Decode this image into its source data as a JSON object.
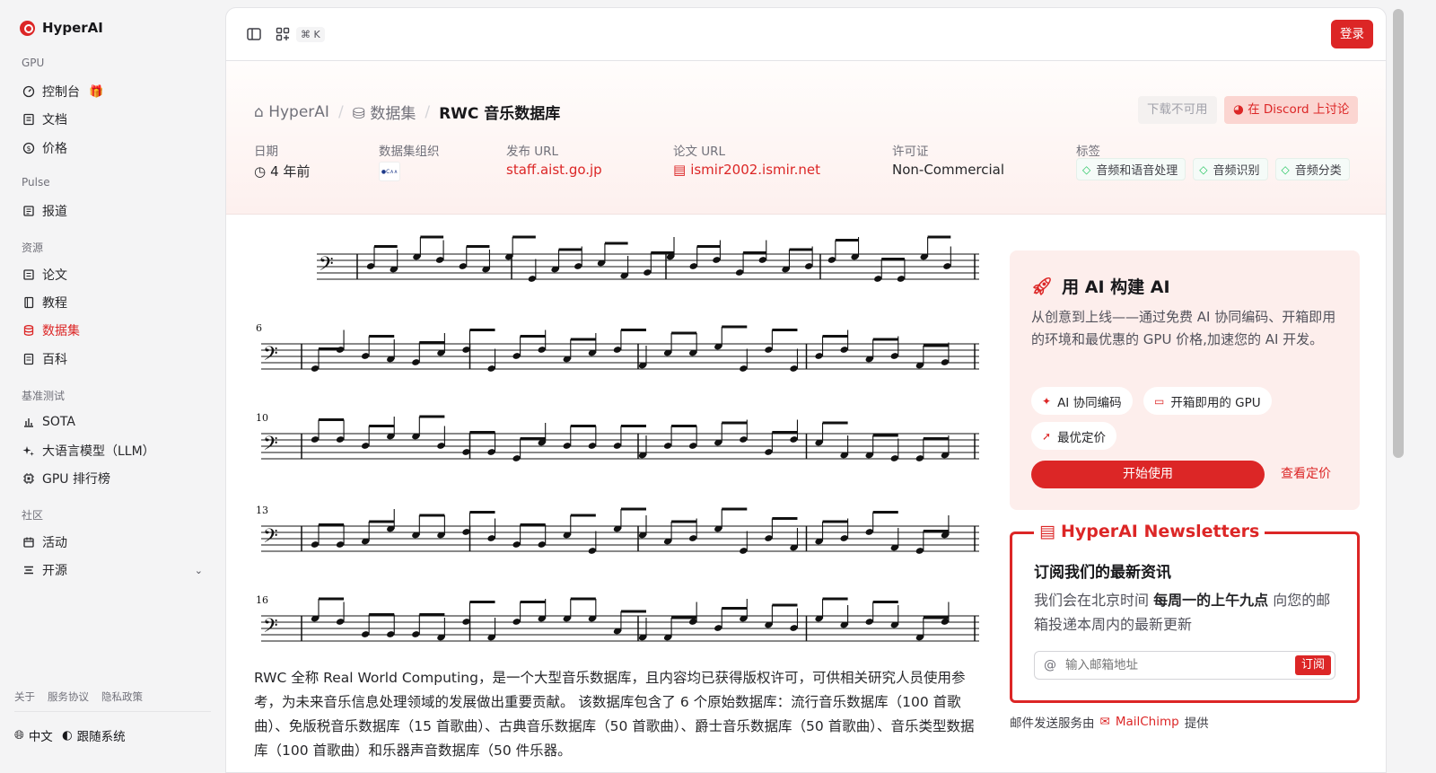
{
  "brand": {
    "name": "HyperAI"
  },
  "sidebar": {
    "sections": [
      {
        "title": "GPU"
      },
      {
        "title": "Pulse"
      },
      {
        "title": "资源"
      },
      {
        "title": "基准测试"
      },
      {
        "title": "社区"
      }
    ],
    "items": [
      {
        "label": "控制台",
        "icon": "dashboard-icon"
      },
      {
        "label": "文档",
        "icon": "document-icon"
      },
      {
        "label": "价格",
        "icon": "dollar-icon"
      },
      {
        "label": "报道",
        "icon": "newspaper-icon"
      },
      {
        "label": "论文",
        "icon": "paper-icon"
      },
      {
        "label": "教程",
        "icon": "book-icon"
      },
      {
        "label": "数据集",
        "icon": "database-icon",
        "active": true
      },
      {
        "label": "百科",
        "icon": "encyclopedia-icon"
      },
      {
        "label": "SOTA",
        "icon": "bar-chart-icon"
      },
      {
        "label": "大语言模型（LLM）",
        "icon": "sparkle-icon"
      },
      {
        "label": "GPU 排行榜",
        "icon": "cpu-icon"
      },
      {
        "label": "活动",
        "icon": "calendar-icon"
      },
      {
        "label": "开源",
        "icon": "list-icon"
      }
    ],
    "footer_links": [
      "关于",
      "服务协议",
      "隐私政策"
    ],
    "language": "中文",
    "theme": "跟随系统"
  },
  "topbar": {
    "shortcut": "⌘ K",
    "login": "登录"
  },
  "breadcrumb": {
    "home": "HyperAI",
    "section": "数据集",
    "current": "RWC 音乐数据库"
  },
  "actions": {
    "download": "下载不可用",
    "discord": "在 Discord 上讨论"
  },
  "meta": {
    "date_label": "日期",
    "date_value": "4 年前",
    "org_label": "数据集组织",
    "org_logo": "●C∧∧",
    "url_label": "发布 URL",
    "url_value": "staff.aist.go.jp",
    "paper_label": "论文 URL",
    "paper_value": "ismir2002.ismir.net",
    "license_label": "许可证",
    "license_value": "Non-Commercial",
    "tags_label": "标签",
    "tags": [
      "音频和语音处理",
      "音频识别",
      "音频分类"
    ]
  },
  "description": "RWC 全称 Real World Computing，是一个大型音乐数据库，且内容均已获得版权许可，可供相关研究人员使用参考，为未来音乐信息处理领域的发展做出重要贡献。 该数据库包含了 6 个原始数据库：流行音乐数据库（100 首歌曲）、免版税音乐数据库（15 首歌曲）、古典音乐数据库（50 首歌曲）、爵士音乐数据库（50 首歌曲）、音乐类型数据库（100 首歌曲）和乐器声音数据库（50 件乐器。",
  "score": {
    "measure_numbers": [
      "6",
      "10",
      "13",
      "16"
    ]
  },
  "promo": {
    "title": "用 AI 构建 AI",
    "desc": "从创意到上线——通过免费 AI 协同编码、开箱即用的环境和最优惠的 GPU 价格,加速您的 AI 开发。",
    "chips": [
      "AI 协同编码",
      "开箱即用的 GPU",
      "最优定价"
    ],
    "start": "开始使用",
    "pricing": "查看定价"
  },
  "newsletter": {
    "legend": "HyperAI Newsletters",
    "heading": "订阅我们的最新资讯",
    "text_before": "我们会在北京时间 ",
    "text_bold": "每周一的上午九点",
    "text_after": " 向您的邮箱投递本周内的最新更新",
    "placeholder": "输入邮箱地址",
    "subscribe": "订阅",
    "credit_before": "邮件发送服务由",
    "credit_brand": "MailChimp",
    "credit_after": "提供"
  },
  "colors": {
    "accent": "#dc2626",
    "tag_icon": "#22c55e",
    "gift": "#f59e0b"
  }
}
